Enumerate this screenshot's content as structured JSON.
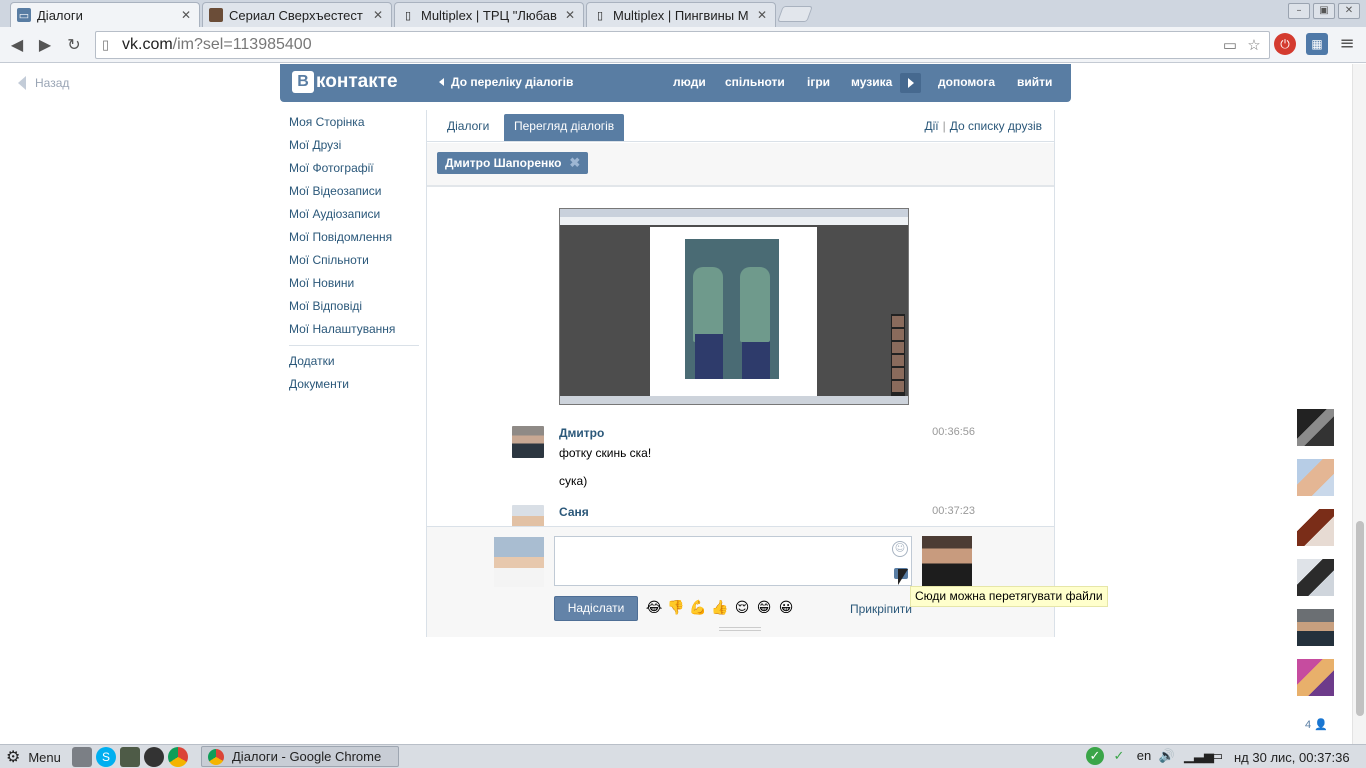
{
  "browser": {
    "tabs": [
      {
        "title": "Діалоги",
        "active": true,
        "icon": "vk-dialogs-favicon"
      },
      {
        "title": "Сериал Сверхъестест",
        "active": false,
        "icon": "serial-favicon"
      },
      {
        "title": "Multiplex | ТРЦ \"Любав",
        "active": false,
        "icon": "page-icon"
      },
      {
        "title": "Multiplex | Пингвины М",
        "active": false,
        "icon": "page-icon"
      }
    ],
    "url_host": "vk.com",
    "url_path": "/im?sel=113985400"
  },
  "page": {
    "back_label": "Назад"
  },
  "vk_header": {
    "logo_letter": "В",
    "logo_text": "контакте",
    "back_to_dialogs": "До переліку діалогів",
    "nav": [
      "люди",
      "спільноти",
      "ігри",
      "музика",
      "допомога",
      "вийти"
    ]
  },
  "left_menu": {
    "items": [
      "Моя Сторінка",
      "Мої Друзі",
      "Мої Фотографії",
      "Мої Відеозаписи",
      "Мої Аудіозаписи",
      "Мої Повідомлення",
      "Мої Спільноти",
      "Мої Новини",
      "Мої Відповіді",
      "Мої Налаштування"
    ],
    "extra_items": [
      "Додатки",
      "Документи"
    ]
  },
  "dialog": {
    "tabs": [
      "Діалоги",
      "Перегляд діалогів"
    ],
    "active_tab": "Перегляд діалогів",
    "actions": "Дії",
    "to_friends": "До списку друзів",
    "peer_chip": "Дмитро Шапоренко",
    "messages": [
      {
        "author": "Дмитро",
        "time": "00:36:56",
        "lines": [
          "фотку скинь ска!",
          "сука)"
        ]
      },
      {
        "author": "Саня",
        "time": "00:37:23",
        "lines": []
      }
    ],
    "send_label": "Надіслати",
    "attach_label": "Прикріпити",
    "emoji": [
      "😂",
      "👎",
      "💪",
      "👍",
      "😌",
      "😁",
      "😀"
    ],
    "tooltip": "Сюди можна перетягувати файли"
  },
  "friends_online": {
    "count": "4"
  },
  "os_taskbar": {
    "menu_label": "Menu",
    "window_title": "Діалоги - Google Chrome",
    "keyboard_layout": "en",
    "clock": "нд 30 лис, 00:37:36"
  },
  "colors": {
    "vk_blue": "#597da3",
    "vk_link": "#2b587a",
    "tooltip_bg": "#ffffcc"
  }
}
